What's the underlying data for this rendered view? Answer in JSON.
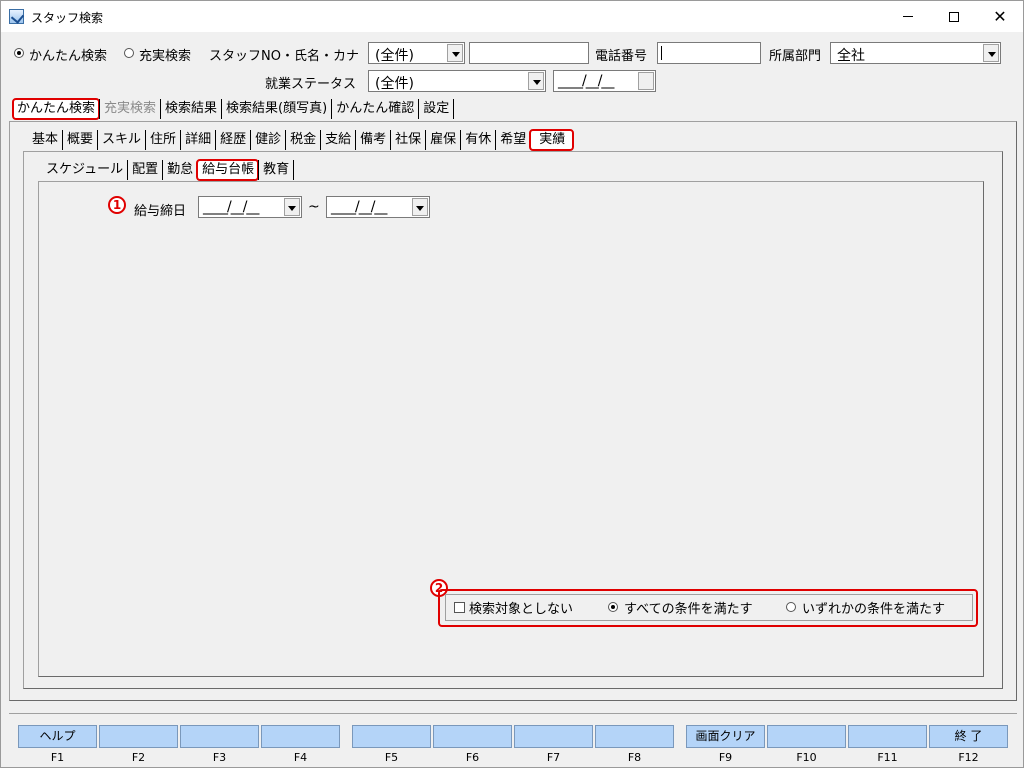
{
  "window": {
    "title": "スタッフ検索"
  },
  "header": {
    "mode_simple": "かんたん検索",
    "mode_full": "充実検索",
    "staff_label": "スタッフNO・氏名・カナ",
    "staff_combo": "(全件)",
    "staff_text": "",
    "phone_label": "電話番号",
    "phone_value": "",
    "dept_label": "所属部門",
    "dept_value": "全社",
    "status_label": "就業ステータス",
    "status_combo": "(全件)",
    "status_date": "____/__/__"
  },
  "main_tabs": [
    "かんたん検索",
    "充実検索",
    "検索結果",
    "検索結果(顔写真)",
    "かんたん確認",
    "設定"
  ],
  "sub_tabs": [
    "基本",
    "概要",
    "スキル",
    "住所",
    "詳細",
    "経歴",
    "健診",
    "税金",
    "支給",
    "備考",
    "社保",
    "雇保",
    "有休",
    "希望",
    "実績"
  ],
  "sub_sub_tabs": [
    "スケジュール",
    "配置",
    "勤怠",
    "給与台帳",
    "教育"
  ],
  "content": {
    "marker1": "1",
    "pay_date_label": "給与締日",
    "date_from": "____/__/__",
    "tilde": "~",
    "date_to": "____/__/__",
    "marker2": "2",
    "exclude_label": "検索対象としない",
    "all_cond_label": "すべての条件を満たす",
    "any_cond_label": "いずれかの条件を満たす"
  },
  "fkeys": [
    {
      "label": "ヘルプ",
      "key": "F1"
    },
    {
      "label": "",
      "key": "F2"
    },
    {
      "label": "",
      "key": "F3"
    },
    {
      "label": "",
      "key": "F4"
    },
    {
      "label": "",
      "key": "F5"
    },
    {
      "label": "",
      "key": "F6"
    },
    {
      "label": "",
      "key": "F7"
    },
    {
      "label": "",
      "key": "F8"
    },
    {
      "label": "画面クリア",
      "key": "F9"
    },
    {
      "label": "",
      "key": "F10"
    },
    {
      "label": "",
      "key": "F11"
    },
    {
      "label": "終 了",
      "key": "F12"
    }
  ]
}
